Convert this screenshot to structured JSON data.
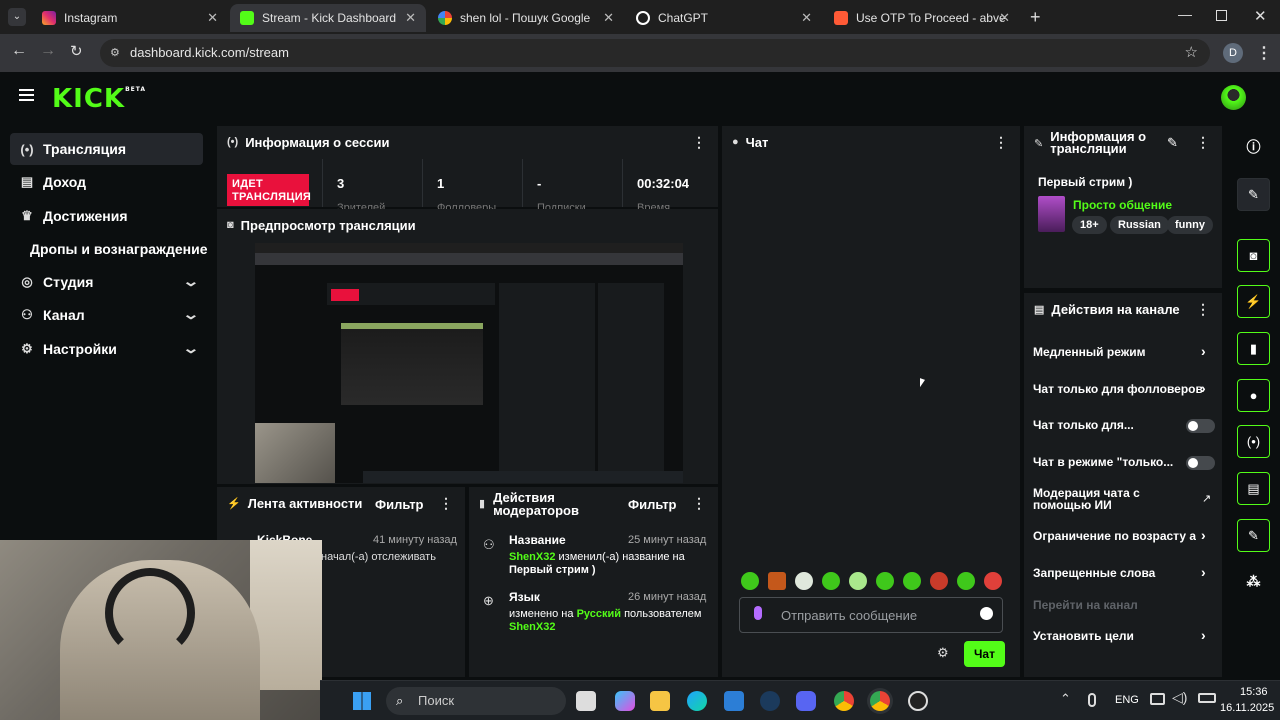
{
  "browser": {
    "tabs": [
      {
        "label": "Instagram",
        "color": "#e1306c"
      },
      {
        "label": "Stream - Kick Dashboard",
        "color": "#53fc18"
      },
      {
        "label": "shen lol - Пошук Google",
        "color": "#4285f4"
      },
      {
        "label": "ChatGPT",
        "color": "#ffffff"
      },
      {
        "label": "Use OTP To Proceed - abventur",
        "color": "#ff5a36"
      }
    ],
    "url": "dashboard.kick.com/stream",
    "profile_initial": "D"
  },
  "kick": {
    "logo": "KICK",
    "logo_badge": "BETA"
  },
  "sidebar": {
    "items": [
      {
        "label": "Трансляция",
        "icon": "broadcast-icon"
      },
      {
        "label": "Доход",
        "icon": "chart-icon"
      },
      {
        "label": "Достижения",
        "icon": "trophy-icon"
      },
      {
        "label": "Дропы и вознаграждение"
      },
      {
        "label": "Студия",
        "icon": "studio-icon"
      },
      {
        "label": "Канал",
        "icon": "channel-icon"
      },
      {
        "label": "Настройки",
        "icon": "settings-icon"
      }
    ]
  },
  "session": {
    "title": "Информация о сессии",
    "live_badge": "ИДЕТ ТРАНСЛЯЦИЯ",
    "stats": [
      {
        "value": "3",
        "label": "Зрителей"
      },
      {
        "value": "1",
        "label": "Фолловеры"
      },
      {
        "value": "-",
        "label": "Подписки"
      },
      {
        "value": "00:32:04",
        "label": "Время"
      }
    ]
  },
  "preview": {
    "title": "Предпросмотр трансляции"
  },
  "activity": {
    "title": "Лента активности",
    "filter": "Фильтр",
    "item_name": "KickBone",
    "item_time": "41 минуту назад",
    "item_text": "начал(-а) отслеживать"
  },
  "moderators": {
    "title": "Действия модераторов",
    "filter": "Фильтр",
    "items": [
      {
        "title": "Название",
        "time": "25 минут назад",
        "user": "ShenX32",
        "text": "изменил(-а) название на",
        "value": "Первый стрим )"
      },
      {
        "title": "Язык",
        "time": "26 минут назад",
        "prefix": "изменено на",
        "lang": "Русский",
        "text": "пользователем",
        "user": "ShenX32"
      }
    ]
  },
  "chat": {
    "title": "Чат",
    "placeholder": "Отправить сообщение",
    "send": "Чат"
  },
  "stream_info": {
    "title": "Информация о трансляции",
    "stream_title": "Первый стрим )",
    "category": "Просто общение",
    "tags": [
      "18+",
      "Russian",
      "funny"
    ],
    "category_color": "#53fc18"
  },
  "channel_actions": {
    "title": "Действия на канале",
    "items": [
      {
        "label": "Медленный режим"
      },
      {
        "label": "Чат только для фолловеров"
      },
      {
        "label": "Чат только для..."
      },
      {
        "label": "Чат в режиме \"только..."
      },
      {
        "label": "Модерация чата с помощью ИИ"
      },
      {
        "label": "Ограничение по возрасту а"
      },
      {
        "label": "Запрещенные слова"
      },
      {
        "label": "Перейти на канал"
      },
      {
        "label": "Установить цели"
      }
    ]
  },
  "taskbar": {
    "search": "Поиск",
    "lang": "ENG",
    "time": "15:36",
    "date": "16.11.2025"
  }
}
